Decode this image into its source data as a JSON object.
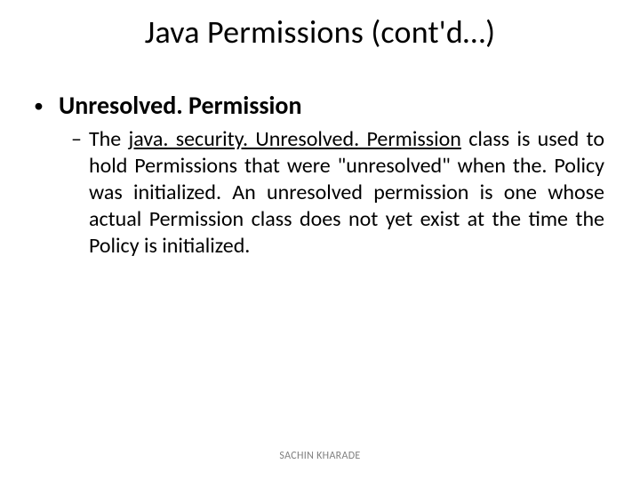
{
  "title": "Java Permissions (cont'd…)",
  "bullet_heading": "Unresolved. Permission",
  "sub_prefix": "The ",
  "sub_underlined": "java. security. Unresolved. Permission",
  "sub_rest": " class is used to hold Permissions that were \"unresolved\" when the. Policy was initialized. An unresolved permission is one whose actual Permission class does not yet exist at the time the Policy is initialized.",
  "footer": "SACHIN KHARADE"
}
